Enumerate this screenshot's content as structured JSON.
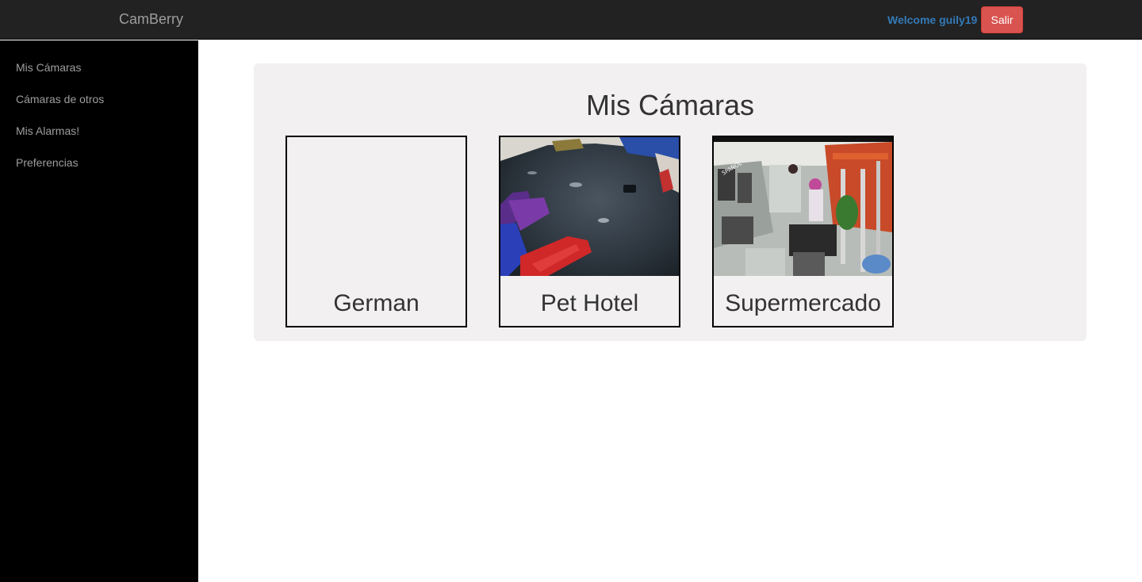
{
  "navbar": {
    "brand": "CamBerry",
    "welcome": "Welcome guily19",
    "logout_label": "Salir"
  },
  "sidebar": {
    "items": [
      {
        "label": "Mis Cámaras"
      },
      {
        "label": "Cámaras de otros"
      },
      {
        "label": "Mis Alarmas!"
      },
      {
        "label": "Preferencias"
      }
    ]
  },
  "main": {
    "title": "Mis Cámaras",
    "cameras": [
      {
        "name": "German",
        "has_image": false
      },
      {
        "name": "Pet Hotel",
        "has_image": true
      },
      {
        "name": "Supermercado",
        "has_image": true
      }
    ]
  },
  "colors": {
    "navbar_bg": "#222222",
    "sidebar_bg": "#000000",
    "panel_bg": "#f2f0f1",
    "welcome_text": "#337ab7",
    "logout_button": "#d9534f"
  }
}
